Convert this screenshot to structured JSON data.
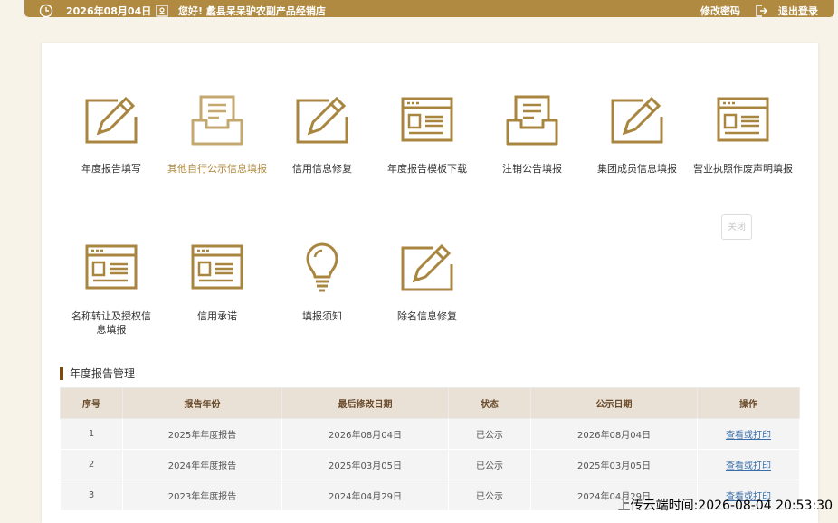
{
  "header": {
    "date": "2026年08月04日",
    "greeting": "您好! 蠡县呆呆驴农副产品经销店",
    "change_password": "修改密码",
    "logout": "退出登录"
  },
  "tiles": [
    {
      "label": "年度报告填写",
      "icon": "edit-pen-icon"
    },
    {
      "label": "其他自行公示信息填报",
      "icon": "inbox-tray-icon"
    },
    {
      "label": "信用信息修复",
      "icon": "edit-pen-icon"
    },
    {
      "label": "年度报告模板下载",
      "icon": "form-window-icon"
    },
    {
      "label": "注销公告填报",
      "icon": "inbox-tray-icon"
    },
    {
      "label": "集团成员信息填报",
      "icon": "edit-pen-icon"
    },
    {
      "label": "营业执照作废声明填报",
      "icon": "form-window-icon"
    },
    {
      "label": "名称转让及授权信息填报",
      "icon": "form-window-icon"
    },
    {
      "label": "信用承诺",
      "icon": "form-window-icon"
    },
    {
      "label": "填报须知",
      "icon": "lightbulb-icon"
    },
    {
      "label": "除名信息修复",
      "icon": "edit-pen-icon"
    }
  ],
  "close_label": "关闭",
  "section_title": "年度报告管理",
  "table": {
    "headers": [
      "序号",
      "报告年份",
      "最后修改日期",
      "状态",
      "公示日期",
      "操作"
    ],
    "rows": [
      [
        "1",
        "2025年年度报告",
        "2026年08月04日",
        "已公示",
        "2026年08月04日",
        "查看或打印"
      ],
      [
        "2",
        "2024年年度报告",
        "2025年03月05日",
        "已公示",
        "2025年03月05日",
        "查看或打印"
      ],
      [
        "3",
        "2023年年度报告",
        "2024年04月29日",
        "已公示",
        "2024年04月29日",
        "查看或打印"
      ]
    ]
  },
  "upload_time": "上传云端时间:2026-08-04 20:53:30",
  "colors": {
    "accent": "#b08a40",
    "title_bar": "#7a4a12",
    "header_bg": "#e9e1d6",
    "link": "#3a6ea8"
  }
}
